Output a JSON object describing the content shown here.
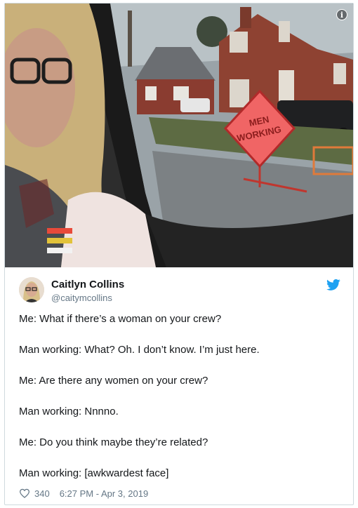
{
  "colors": {
    "twitter_blue": "#1da1f2",
    "name": "#14171a",
    "muted": "#657786"
  },
  "media": {
    "info_icon": "info-icon",
    "sign_line1": "MEN",
    "sign_line2": "WORKING"
  },
  "author": {
    "name": "Caitlyn Collins",
    "handle": "@caitymcollins",
    "logo_icon": "twitter-bird-icon"
  },
  "tweet_lines": [
    "Me: What if there’s a woman on your crew?",
    "Man working: What? Oh. I don’t know. I’m just here.",
    "Me: Are there any women on your crew?",
    "Man working: Nnnno.",
    "Me: Do you think maybe they’re related?",
    "Man working: [awkwardest face]"
  ],
  "footer": {
    "like_icon": "heart-icon",
    "likes": "340",
    "timestamp": "6:27 PM - Apr 3, 2019"
  }
}
